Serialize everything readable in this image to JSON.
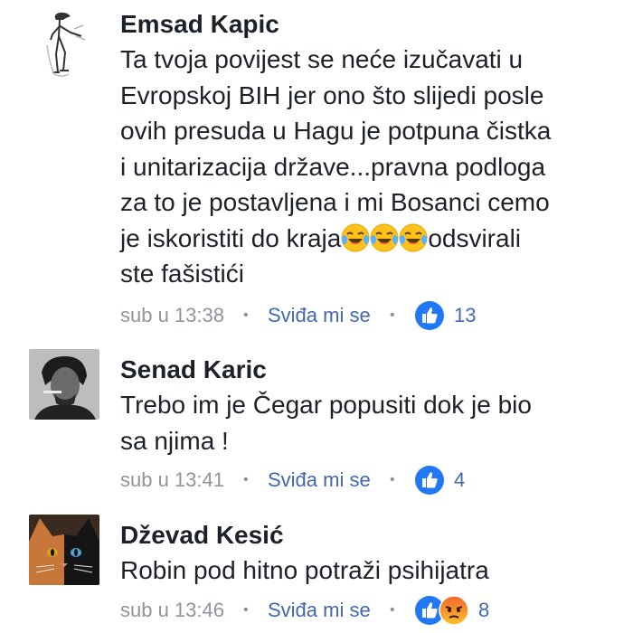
{
  "colors": {
    "text": "#1d2129",
    "meta": "#90949c",
    "link": "#4267b2",
    "like_blue": "#2078f4",
    "angry_orange": "#f2672d"
  },
  "comments": [
    {
      "author": "Emsad Kapic",
      "avatar": "sketch-figure-avatar",
      "lines": [
        "Ta tvoja povijest se neće izučavati u",
        "Evropskoj BIH jer ono što slijedi posle",
        "ovih presuda u Hagu je potpuna čistka",
        "i unitarizacija države...pravna podloga",
        "za to je postavljena i mi Bosanci cemo"
      ],
      "line6_before": "je iskoristiti do kraja",
      "line6_after": "odsvirali",
      "line7": "ste fašistići",
      "emojis": [
        "laughing-crying-emoji",
        "laughing-crying-emoji",
        "laughing-crying-emoji"
      ],
      "time": "sub u 13:38",
      "like_label": "Sviđa mi se",
      "reactions": [
        "like-icon"
      ],
      "count": "13"
    },
    {
      "author": "Senad Karic",
      "avatar": "portrait-photo-avatar",
      "lines": [
        "Trebo im je Čegar popusiti dok je bio",
        "sa njima !"
      ],
      "time": "sub u 13:41",
      "like_label": "Sviđa mi se",
      "reactions": [
        "like-icon"
      ],
      "count": "4"
    },
    {
      "author": "Dževad Kesić",
      "avatar": "cat-photo-avatar",
      "lines": [
        "Robin pod hitno potraži psihijatra"
      ],
      "time": "sub u 13:46",
      "like_label": "Sviđa mi se",
      "reactions": [
        "like-icon",
        "angry-icon"
      ],
      "count": "8"
    }
  ]
}
